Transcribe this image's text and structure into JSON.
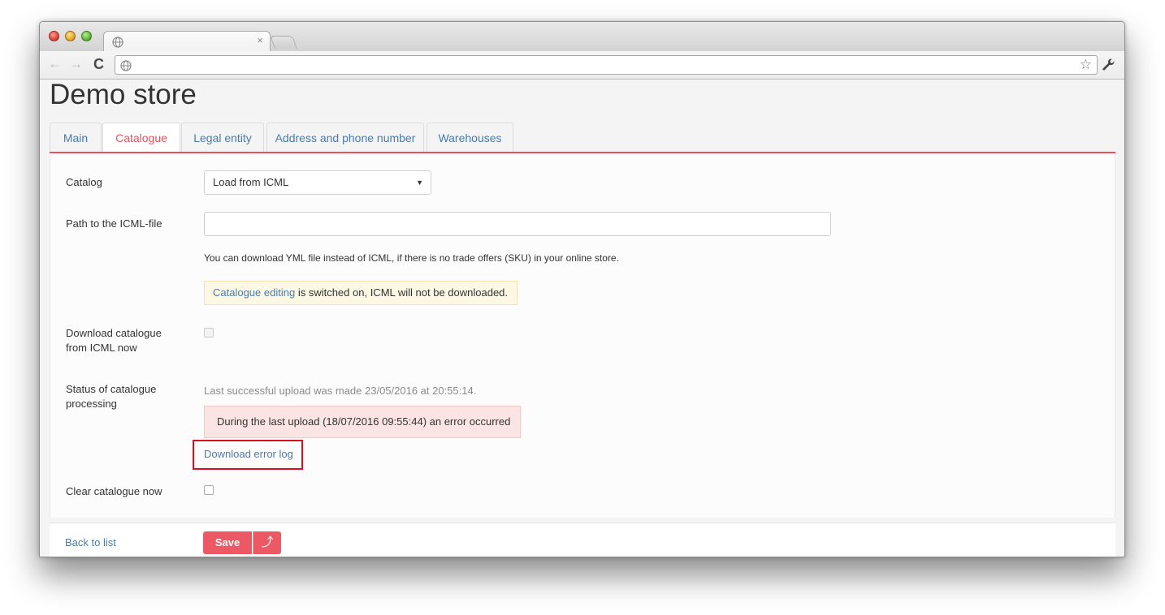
{
  "browser": {
    "tab_close": "×",
    "url": ""
  },
  "page": {
    "title": "Demo store"
  },
  "tabs": [
    {
      "label": "Main"
    },
    {
      "label": "Catalogue"
    },
    {
      "label": "Legal entity"
    },
    {
      "label": "Address and phone number"
    },
    {
      "label": "Warehouses"
    }
  ],
  "active_tab": "Catalogue",
  "form": {
    "catalog_label": "Catalog",
    "catalog_value": "Load from ICML",
    "path_label": "Path to the ICML-file",
    "path_value": "",
    "hint": "You can download YML file instead of ICML, if there is no trade offers (SKU) in your online store.",
    "warning_link": "Catalogue editing",
    "warning_text": " is switched on, ICML will not be downloaded.",
    "download_now_label_1": "Download catalogue",
    "download_now_label_2": "from ICML now",
    "status_label_1": "Status of catalogue",
    "status_label_2": "processing",
    "last_upload": "Last successful upload was made 23/05/2016 at 20:55:14.",
    "error_message": "During the last upload (18/07/2016 09:55:44) an error occurred",
    "download_error_log": "Download error log",
    "clear_label": "Clear catalogue now"
  },
  "footer": {
    "back_link": "Back to list",
    "save_label": "Save",
    "save_up_icon": "⤴"
  },
  "colors": {
    "accent": "#e8505b",
    "link": "#4a7bab",
    "highlight": "#d9101d"
  }
}
